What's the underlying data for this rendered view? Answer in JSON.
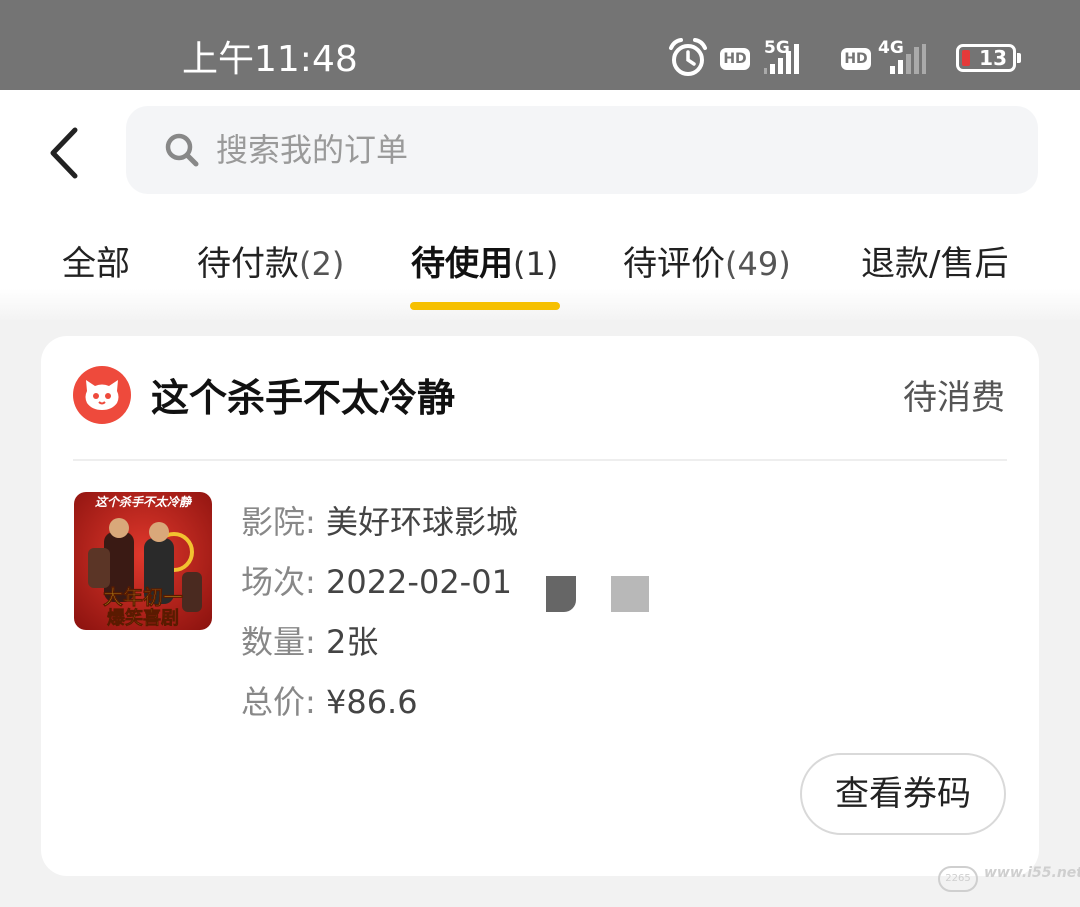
{
  "status_bar": {
    "time": "上午11:48",
    "hd_label": "HD",
    "sim1_network": "5G",
    "sim2_network": "4G",
    "battery_level": "13"
  },
  "header": {
    "search_placeholder": "搜索我的订单"
  },
  "tabs": [
    {
      "label": "全部",
      "count": ""
    },
    {
      "label": "待付款",
      "count": "(2)"
    },
    {
      "label": "待使用",
      "count": "(1)",
      "active": true
    },
    {
      "label": "待评价",
      "count": "(49)"
    },
    {
      "label": "退款/售后",
      "count": ""
    }
  ],
  "order": {
    "title": "这个杀手不太冷静",
    "status": "待消费",
    "poster_text_top": "这个杀手不太冷静",
    "poster_text_line1": "大年初一",
    "poster_text_line2": "爆笑喜剧",
    "cinema_label": "影院:",
    "cinema_value": "美好环球影城",
    "session_label": "场次:",
    "session_value": "2022-02-01",
    "quantity_label": "数量:",
    "quantity_value": "2张",
    "total_label": "总价:",
    "total_value": "¥86.6",
    "view_code_button": "查看券码"
  },
  "watermark": {
    "badge": "2265",
    "site": "www.i55.net"
  },
  "colors": {
    "accent_underline": "#f6c000",
    "brand_red": "#ee4a3c",
    "status_bar": "#747474"
  }
}
